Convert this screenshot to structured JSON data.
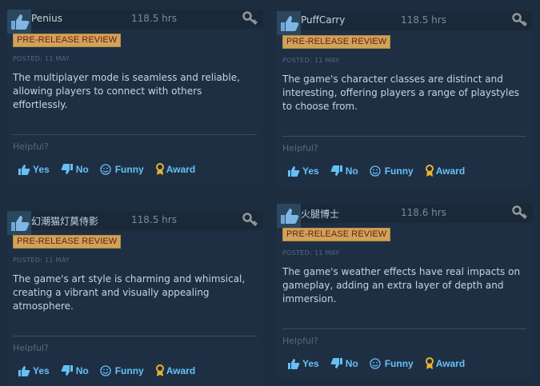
{
  "reviews": [
    {
      "username": "Penius",
      "hours": "118.5 hrs",
      "badge": "PRE-RELEASE REVIEW",
      "posted": "POSTED: 11 MAY",
      "text": "The multiplayer mode is seamless and reliable, allowing players to connect with others effortlessly.",
      "helpful": "Helpful?",
      "actions": {
        "yes": "Yes",
        "no": "No",
        "funny": "Funny",
        "award": "Award"
      }
    },
    {
      "username": "PuffCarry",
      "hours": "118.5 hrs",
      "badge": "PRE-RELEASE REVIEW",
      "posted": "POSTED: 11 MAY",
      "text": "The game's character classes are distinct and interesting, offering players a range of playstyles to choose from.",
      "helpful": "Helpful?",
      "actions": {
        "yes": "Yes",
        "no": "No",
        "funny": "Funny",
        "award": "Award"
      }
    },
    {
      "username": "幻潮猫灯莫侍影",
      "hours": "118.5 hrs",
      "badge": "PRE-RELEASE REVIEW",
      "posted": "POSTED: 11 MAY",
      "text": "The game's art style is charming and whimsical, creating a vibrant and visually appealing atmosphere.",
      "helpful": "Helpful?",
      "actions": {
        "yes": "Yes",
        "no": "No",
        "funny": "Funny",
        "award": "Award"
      }
    },
    {
      "username": "火腿博士",
      "hours": "118.6 hrs",
      "badge": "PRE-RELEASE REVIEW",
      "posted": "POSTED: 11 MAY",
      "text": "The game's weather effects have real impacts on gameplay, adding an extra layer of depth and immersion.",
      "helpful": "Helpful?",
      "actions": {
        "yes": "Yes",
        "no": "No",
        "funny": "Funny",
        "award": "Award"
      }
    }
  ],
  "colors": {
    "background": "#1d2d40",
    "badge_bg": "#cfa35a",
    "badge_text": "#6b1c10",
    "action_blue": "#66c0f4",
    "award_gold": "#e8b32a"
  },
  "icons": {
    "avatar": "thumbs-up-avatar-icon",
    "key": "key-icon",
    "yes": "thumbs-up-icon",
    "no": "thumbs-down-icon",
    "funny": "smiley-icon",
    "award": "award-ribbon-icon"
  }
}
